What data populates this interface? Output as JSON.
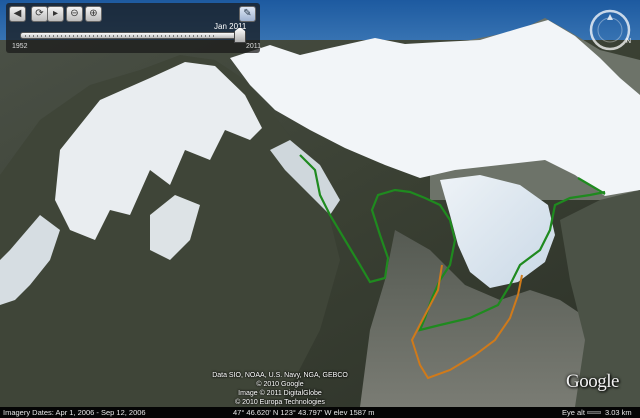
{
  "time_slider": {
    "current_date": "Jan 2011",
    "start_year": "1952",
    "end_year": "2011",
    "position_fraction": 0.98,
    "buttons": [
      {
        "name": "back-icon",
        "glyph": "◀"
      },
      {
        "name": "play-icon",
        "glyph": "⟳"
      },
      {
        "name": "forward-icon",
        "glyph": "▸"
      },
      {
        "name": "zoom-out-icon",
        "glyph": "⊖"
      },
      {
        "name": "zoom-in-icon",
        "glyph": "⊕"
      },
      {
        "name": "wrench-icon",
        "glyph": "✎"
      }
    ]
  },
  "compass": {
    "north_label": "N"
  },
  "overlays": {
    "green_outline_color": "#1f8a1f",
    "orange_outline_color": "#d07a1a"
  },
  "attribution": {
    "line1": "Data SIO, NOAA, U.S. Navy, NGA, GEBCO",
    "line2": "© 2010 Google",
    "line3": "Image © 2011 DigitalGlobe",
    "line4": "© 2010 Europa Technologies"
  },
  "logo": {
    "text": "Google"
  },
  "status_bar": {
    "imagery_dates": "Imagery Dates: Apr 1, 2006 - Sep 12, 2006",
    "coordinates": "47° 46.620' N    123° 43.797' W    elev 1587 m",
    "eye_alt_label": "Eye alt",
    "eye_alt_value": "3.03 km"
  }
}
